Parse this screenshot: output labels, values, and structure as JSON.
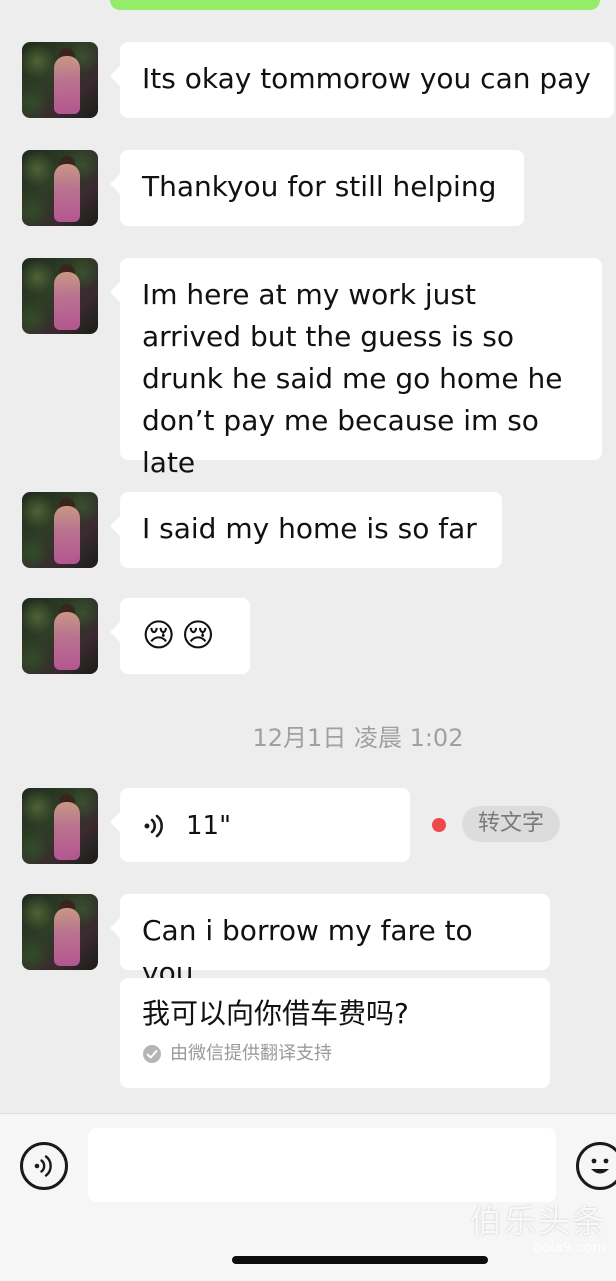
{
  "messages": [
    {
      "text": "Its okay tommorow you can pay"
    },
    {
      "text": "Thankyou for still helping"
    },
    {
      "text": "Im here at my work just arrived but the guess is so drunk he said me go home he don’t pay me because im so late"
    },
    {
      "text": "I said my home is so far"
    },
    {
      "text": "😢😢"
    }
  ],
  "timestamp": "12月1日 凌晨 1:02",
  "voice_message": {
    "duration": "11\"",
    "to_text_label": "转文字",
    "unread_color": "#f04848"
  },
  "last_message": {
    "text": "Can i borrow my fare to you",
    "translation": "我可以向你借车费吗?",
    "translation_note": "由微信提供翻译支持"
  },
  "input_bar": {
    "voice_icon": "voice-icon",
    "emoji_icon": "emoji-icon"
  },
  "watermark": {
    "title": "伯乐头条",
    "subtitle": "bola9.com"
  },
  "colors": {
    "background": "#ededed",
    "bubble": "#ffffff",
    "sent_bubble": "#95ec69"
  }
}
